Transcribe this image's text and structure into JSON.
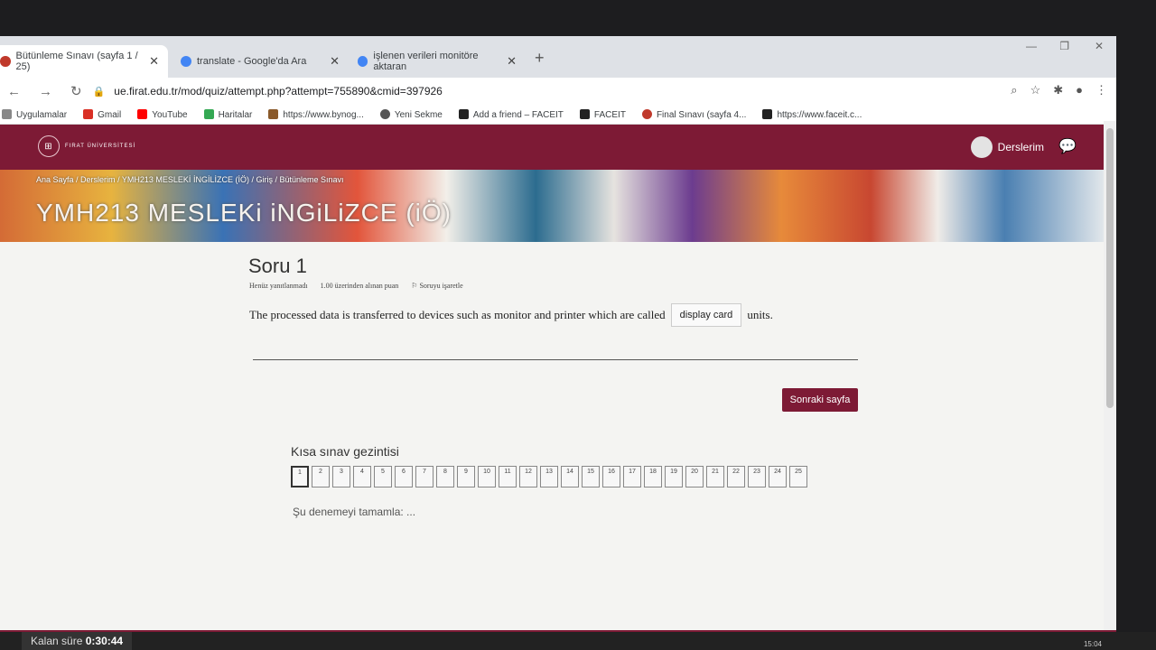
{
  "browser": {
    "tabs": [
      {
        "title": "Bütünleme Sınavı (sayfa 1 / 25)",
        "active": true
      },
      {
        "title": "translate - Google'da Ara",
        "active": false
      },
      {
        "title": "işlenen verileri monitöre aktaran",
        "active": false
      }
    ],
    "new_tab": "+",
    "url": "ue.firat.edu.tr/mod/quiz/attempt.php?attempt=755890&cmid=397926",
    "bookmarks": [
      "Uygulamalar",
      "Gmail",
      "YouTube",
      "Haritalar",
      "https://www.bynog...",
      "Yeni Sekme",
      "Add a friend – FACEIT",
      "FACEIT",
      "Final Sınavı (sayfa 4...",
      "https://www.faceit.c..."
    ]
  },
  "site": {
    "logo_text": "FIRAT ÜNİVERSİTESİ",
    "user_label": "Derslerim",
    "breadcrumb": [
      "Ana Sayfa",
      "Derslerim",
      "YMH213 MESLEKİ İNGİLİZCE (İÖ)",
      "Giriş",
      "Bütünleme Sınavı"
    ],
    "course_title": "YMH213 MESLEKi iNGiLiZCE (iÖ)"
  },
  "question": {
    "title": "Soru 1",
    "status": "Henüz yanıtlanmadı",
    "points": "1.00 üzerinden alınan puan",
    "flag": "Soruyu işaretle",
    "text_before": "The processed data is transferred to devices such as monitor and printer which are called",
    "answer": "display card",
    "text_after": "units."
  },
  "next_button": "Sonraki sayfa",
  "quiz_nav": {
    "title": "Kısa sınav gezintisi",
    "questions": [
      "1",
      "2",
      "3",
      "4",
      "5",
      "6",
      "7",
      "8",
      "9",
      "10",
      "11",
      "12",
      "13",
      "14",
      "15",
      "16",
      "17",
      "18",
      "19",
      "20",
      "21",
      "22",
      "23",
      "24",
      "25"
    ],
    "current": "1",
    "finish": "Şu denemeyi tamamla: ..."
  },
  "timer": {
    "label": "Kalan süre",
    "value": "0:30:44"
  },
  "clock": {
    "time": "15:04"
  },
  "colors": {
    "brand": "#7d1a35"
  }
}
